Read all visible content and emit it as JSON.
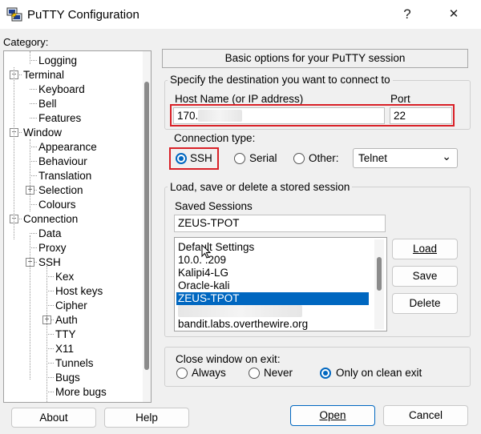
{
  "window": {
    "title": "PuTTY Configuration",
    "help_glyph": "?",
    "close_glyph": "✕"
  },
  "category": {
    "label": "Category:",
    "items": [
      {
        "label": "Logging"
      },
      {
        "label": "Terminal",
        "box": "−"
      },
      {
        "label": "Keyboard"
      },
      {
        "label": "Bell"
      },
      {
        "label": "Features"
      },
      {
        "label": "Window",
        "box": "−"
      },
      {
        "label": "Appearance"
      },
      {
        "label": "Behaviour"
      },
      {
        "label": "Translation"
      },
      {
        "label": "Selection",
        "box": "+"
      },
      {
        "label": "Colours"
      },
      {
        "label": "Connection",
        "box": "−"
      },
      {
        "label": "Data"
      },
      {
        "label": "Proxy"
      },
      {
        "label": "SSH",
        "box": "−"
      },
      {
        "label": "Kex"
      },
      {
        "label": "Host keys"
      },
      {
        "label": "Cipher"
      },
      {
        "label": "Auth",
        "box": "+"
      },
      {
        "label": "TTY"
      },
      {
        "label": "X11"
      },
      {
        "label": "Tunnels"
      },
      {
        "label": "Bugs"
      },
      {
        "label": "More bugs"
      }
    ]
  },
  "panel": {
    "header": "Basic options for your PuTTY session",
    "destination": {
      "group_title": "Specify the destination you want to connect to",
      "host_label": "Host Name (or IP address)",
      "host_value": "170.",
      "port_label": "Port",
      "port_value": "22"
    },
    "conn_type": {
      "label": "Connection type:",
      "ssh": "SSH",
      "serial": "Serial",
      "other": "Other:",
      "select_value": "Telnet",
      "chevron": "⌄"
    },
    "sessions": {
      "group_title": "Load, save or delete a stored session",
      "saved_label": "Saved Sessions",
      "saved_value": "ZEUS-TPOT",
      "list": [
        "Default Settings",
        "10.0.  .209",
        "Kalipi4-LG",
        "Oracle-kali",
        "ZEUS-TPOT",
        "",
        "bandit.labs.overthewire.org"
      ],
      "selected_index": 4,
      "load": "Load",
      "save": "Save",
      "delete": "Delete"
    },
    "close_window": {
      "label": "Close window on exit:",
      "always": "Always",
      "never": "Never",
      "clean": "Only on clean exit"
    }
  },
  "footer": {
    "about": "About",
    "help": "Help",
    "open": "Open",
    "cancel": "Cancel"
  }
}
